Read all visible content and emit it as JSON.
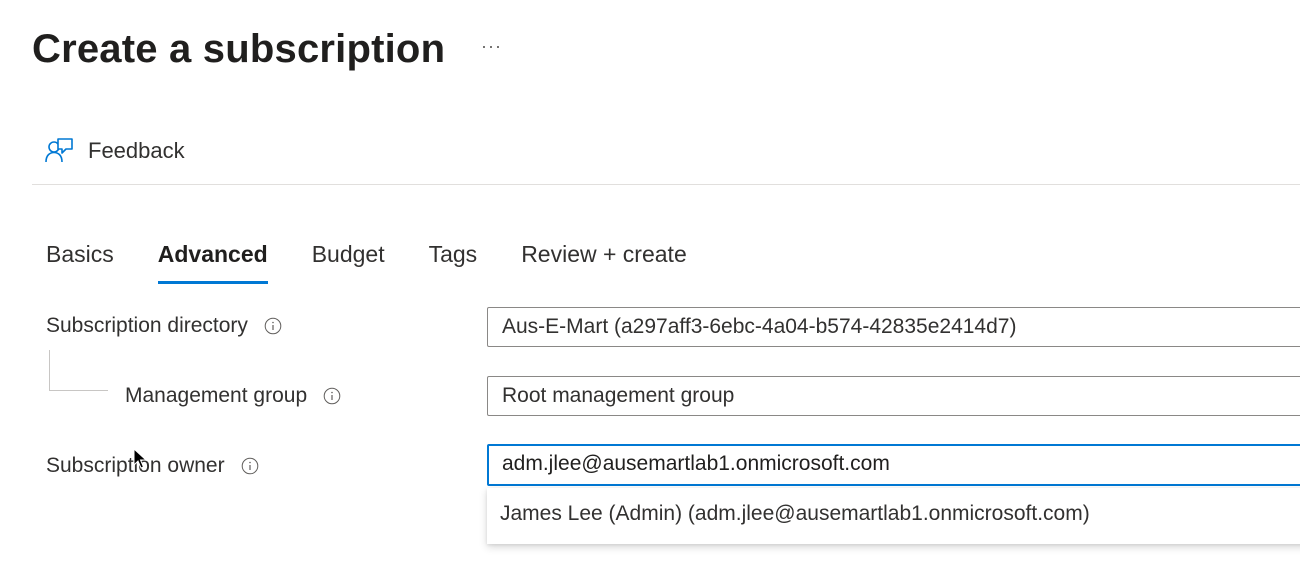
{
  "page": {
    "title": "Create a subscription",
    "more_label": "···"
  },
  "toolbar": {
    "feedback_label": "Feedback",
    "feedback_icon": "feedback-icon"
  },
  "tabs": [
    {
      "label": "Basics",
      "active": false
    },
    {
      "label": "Advanced",
      "active": true
    },
    {
      "label": "Budget",
      "active": false
    },
    {
      "label": "Tags",
      "active": false
    },
    {
      "label": "Review + create",
      "active": false
    }
  ],
  "form": {
    "subscription_directory": {
      "label": "Subscription directory",
      "value": "Aus-E-Mart (a297aff3-6ebc-4a04-b574-42835e2414d7)"
    },
    "management_group": {
      "label": "Management group",
      "value": "Root management group"
    },
    "subscription_owner": {
      "label": "Subscription owner",
      "value": "adm.jlee@ausemartlab1.onmicrosoft.com"
    }
  },
  "owner_suggestions": [
    "James Lee (Admin) (adm.jlee@ausemartlab1.onmicrosoft.com)"
  ],
  "colors": {
    "accent": "#0078d4",
    "text": "#323130",
    "border": "#8a8886"
  }
}
